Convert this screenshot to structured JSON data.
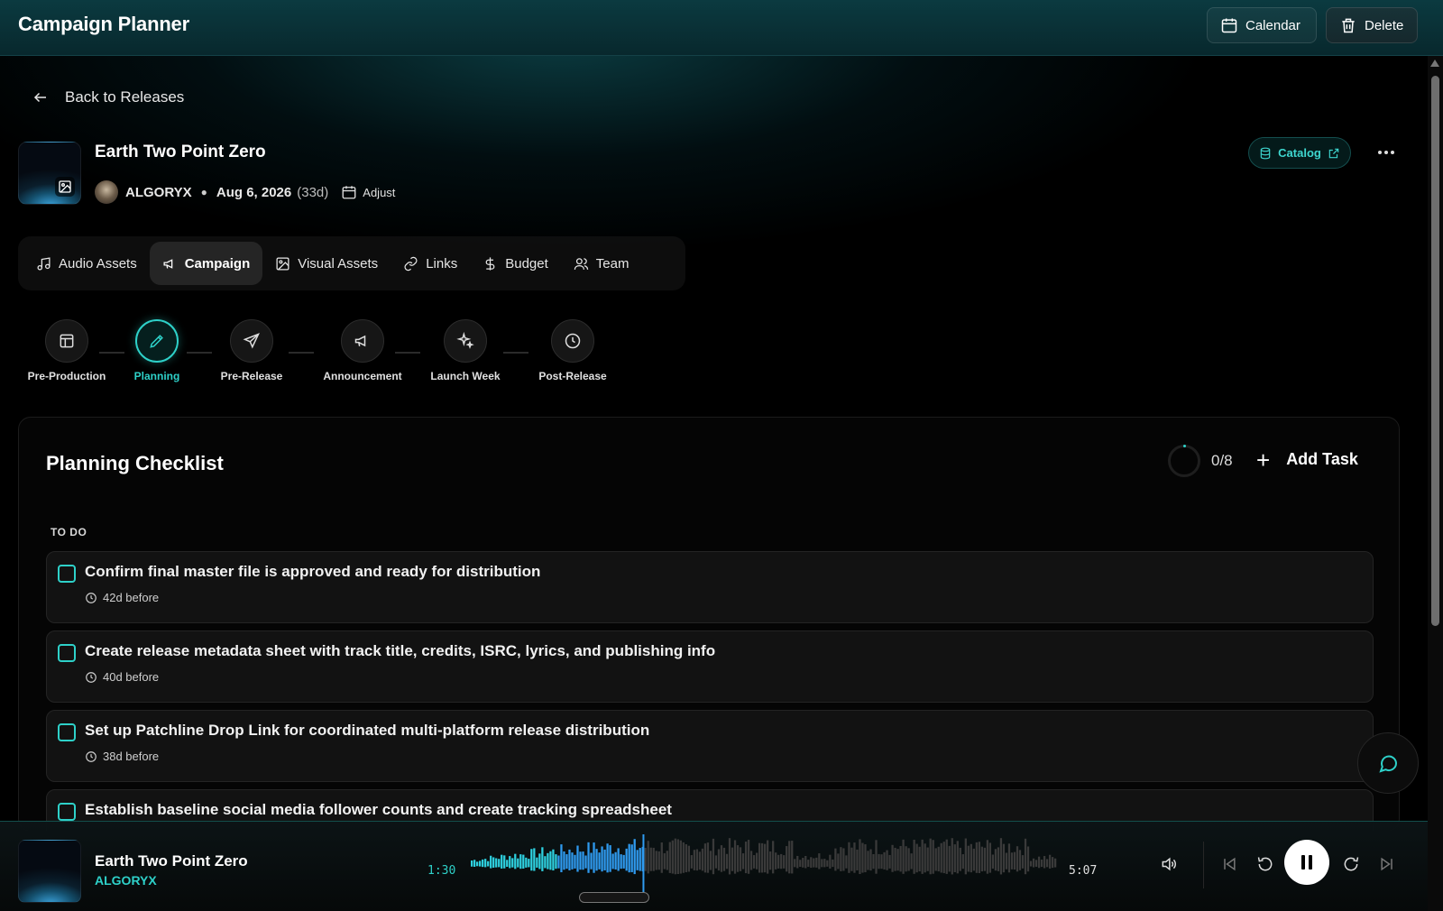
{
  "app": {
    "title": "Campaign Planner",
    "calendar_label": "Calendar",
    "delete_label": "Delete"
  },
  "nav": {
    "back_label": "Back to Releases"
  },
  "release": {
    "title": "Earth Two Point Zero",
    "artist": "ALGORYX",
    "date": "Aug 6, 2026",
    "days_remaining": "(33d)",
    "adjust_label": "Adjust",
    "catalog_label": "Catalog"
  },
  "tabs": [
    {
      "label": "Audio Assets",
      "icon": "music-note-icon",
      "active": false
    },
    {
      "label": "Campaign",
      "icon": "megaphone-icon",
      "active": true
    },
    {
      "label": "Visual Assets",
      "icon": "image-icon",
      "active": false
    },
    {
      "label": "Links",
      "icon": "link-icon",
      "active": false
    },
    {
      "label": "Budget",
      "icon": "dollar-icon",
      "active": false
    },
    {
      "label": "Team",
      "icon": "users-icon",
      "active": false
    }
  ],
  "phases": [
    {
      "label": "Pre-Production",
      "icon": "layout-icon",
      "active": false
    },
    {
      "label": "Planning",
      "icon": "pencil-icon",
      "active": true
    },
    {
      "label": "Pre-Release",
      "icon": "send-icon",
      "active": false
    },
    {
      "label": "Announcement",
      "icon": "megaphone-icon",
      "active": false
    },
    {
      "label": "Launch Week",
      "icon": "sparkles-icon",
      "active": false
    },
    {
      "label": "Post-Release",
      "icon": "clock-icon",
      "active": false
    }
  ],
  "checklist": {
    "title": "Planning Checklist",
    "progress_text": "0/8",
    "completed": 0,
    "total": 8,
    "add_task_label": "Add Task",
    "section_label": "TO DO",
    "tasks": [
      {
        "text": "Confirm final master file is approved and ready for distribution",
        "due": "42d before"
      },
      {
        "text": "Create release metadata sheet with track title, credits, ISRC, lyrics, and publishing info",
        "due": "40d before"
      },
      {
        "text": "Set up Patchline Drop Link for coordinated multi-platform release distribution",
        "due": "38d before"
      },
      {
        "text": "Establish baseline social media follower counts and create tracking spreadsheet",
        "due": ""
      }
    ]
  },
  "player": {
    "title": "Earth Two Point Zero",
    "artist": "ALGORYX",
    "current_time": "1:30",
    "total_time": "5:07",
    "progress_fraction": 0.293,
    "is_playing": true
  },
  "colors": {
    "accent": "#2ed1c9",
    "background": "#000000",
    "topbar": "#0b3a40"
  }
}
